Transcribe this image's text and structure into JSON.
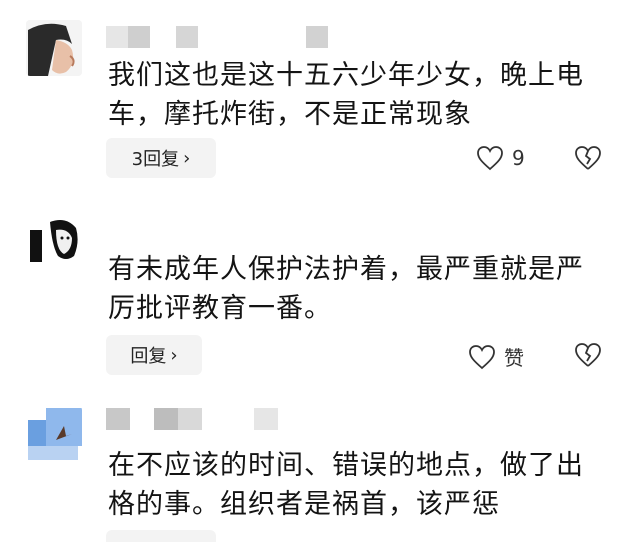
{
  "comments": [
    {
      "text": "我们这也是这十五六少年少女，晚上电车，摩托炸街，不是正常现象",
      "reply_label": "3回复",
      "like_count": "9"
    },
    {
      "text": "有未成年人保护法护着，最严重就是严厉批评教育一番。",
      "reply_label": "回复",
      "like_count": "赞"
    },
    {
      "text": "在不应该的时间、错误的地点，做了出格的事。组织者是祸首，该严惩",
      "reply_label": "",
      "like_count": ""
    }
  ]
}
